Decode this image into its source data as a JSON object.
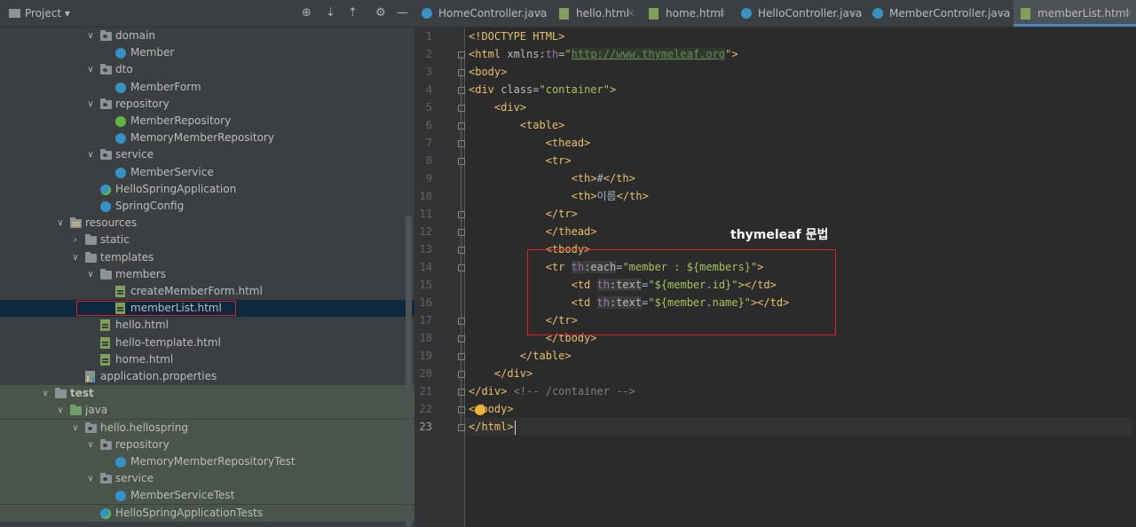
{
  "project_panel": {
    "title": "Project",
    "tree": [
      {
        "label": "domain",
        "kind": "pkg",
        "depth": 3,
        "expanded": true
      },
      {
        "label": "Member",
        "kind": "class",
        "depth": 4
      },
      {
        "label": "dto",
        "kind": "pkg",
        "depth": 3,
        "expanded": true
      },
      {
        "label": "MemberForm",
        "kind": "class",
        "depth": 4
      },
      {
        "label": "repository",
        "kind": "pkg",
        "depth": 3,
        "expanded": true
      },
      {
        "label": "MemberRepository",
        "kind": "interface",
        "depth": 4
      },
      {
        "label": "MemoryMemberRepository",
        "kind": "class",
        "depth": 4
      },
      {
        "label": "service",
        "kind": "pkg",
        "depth": 3,
        "expanded": true
      },
      {
        "label": "MemberService",
        "kind": "class",
        "depth": 4
      },
      {
        "label": "HelloSpringApplication",
        "kind": "app",
        "depth": 3
      },
      {
        "label": "SpringConfig",
        "kind": "class",
        "depth": 3
      },
      {
        "label": "resources",
        "kind": "res",
        "depth": 1,
        "expanded": true
      },
      {
        "label": "static",
        "kind": "folder",
        "depth": 2,
        "expanded": false
      },
      {
        "label": "templates",
        "kind": "folder",
        "depth": 2,
        "expanded": true
      },
      {
        "label": "members",
        "kind": "folder",
        "depth": 3,
        "expanded": true
      },
      {
        "label": "createMemberForm.html",
        "kind": "html",
        "depth": 4
      },
      {
        "label": "memberList.html",
        "kind": "html",
        "depth": 4,
        "selected": true
      },
      {
        "label": "hello.html",
        "kind": "html",
        "depth": 3
      },
      {
        "label": "hello-template.html",
        "kind": "html",
        "depth": 3
      },
      {
        "label": "home.html",
        "kind": "html",
        "depth": 3
      },
      {
        "label": "application.properties",
        "kind": "props",
        "depth": 2
      },
      {
        "label": "test",
        "kind": "testroot",
        "depth": 0,
        "expanded": true,
        "test": true
      },
      {
        "label": "java",
        "kind": "testsrc",
        "depth": 1,
        "expanded": true,
        "test": true
      },
      {
        "label": "hello.hellospring",
        "kind": "pkg",
        "depth": 2,
        "expanded": true,
        "test": true
      },
      {
        "label": "repository",
        "kind": "pkg",
        "depth": 3,
        "expanded": true,
        "test": true
      },
      {
        "label": "MemoryMemberRepositoryTest",
        "kind": "class",
        "depth": 4,
        "test": true
      },
      {
        "label": "service",
        "kind": "pkg",
        "depth": 3,
        "expanded": true,
        "test": true
      },
      {
        "label": "MemberServiceTest",
        "kind": "class",
        "depth": 4,
        "test": true
      },
      {
        "label": "HelloSpringApplicationTests",
        "kind": "app",
        "depth": 3,
        "test": true
      }
    ]
  },
  "tabs": [
    {
      "label": "HomeController.java",
      "type": "java",
      "active": false
    },
    {
      "label": "hello.html",
      "type": "html",
      "active": false
    },
    {
      "label": "home.html",
      "type": "html",
      "active": false
    },
    {
      "label": "HelloController.java",
      "type": "java",
      "active": false
    },
    {
      "label": "MemberController.java",
      "type": "java",
      "active": false
    },
    {
      "label": "memberList.html",
      "type": "html",
      "active": true
    }
  ],
  "editor": {
    "current_line": 23,
    "annotation_label": "thymeleaf 문법",
    "lines": [
      "1",
      "2",
      "3",
      "4",
      "5",
      "6",
      "7",
      "8",
      "9",
      "10",
      "11",
      "12",
      "13",
      "14",
      "15",
      "16",
      "17",
      "18",
      "19",
      "20",
      "21",
      "22",
      "23"
    ]
  },
  "icons": {
    "close": "×",
    "dropdown": "▾",
    "target": "⊕",
    "collapse_all": "⇣",
    "expand_all": "⇡",
    "settings": "⚙",
    "hide": "—"
  }
}
